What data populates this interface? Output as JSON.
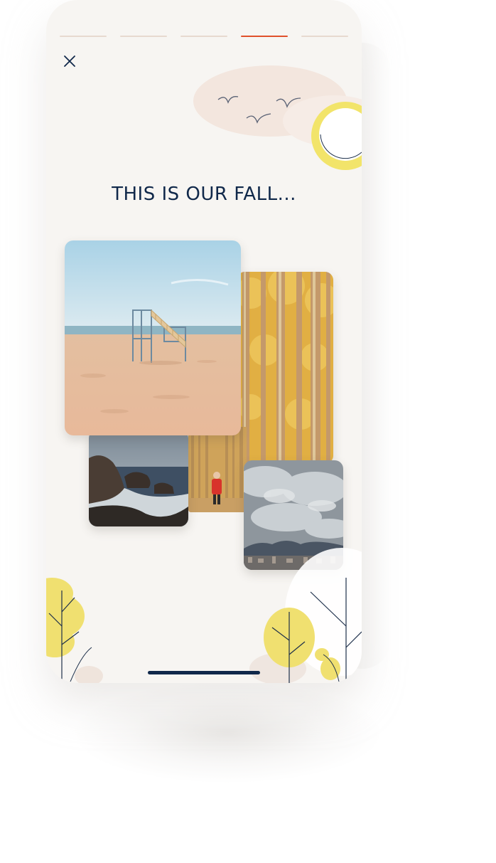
{
  "story": {
    "title": "THIS IS OUR FALL...",
    "progress": {
      "segments": 5,
      "active_index": 3
    },
    "colors": {
      "background": "#f7f5f2",
      "accent": "#e0512b",
      "segment_inactive": "#e7d9cf",
      "title": "#10284a",
      "sun": "#f2e46a",
      "tree_yellow": "#f0e070"
    },
    "icons": {
      "close": "close-icon",
      "birds": "birds-illustration",
      "sun": "sun-illustration",
      "trees": "tree-illustration"
    },
    "photos": [
      {
        "subject": "beach-lifeguard-tower"
      },
      {
        "subject": "autumn-poplar-forest"
      },
      {
        "subject": "rocky-seashore"
      },
      {
        "subject": "person-in-forest"
      },
      {
        "subject": "cloudy-city-skyline"
      }
    ]
  }
}
